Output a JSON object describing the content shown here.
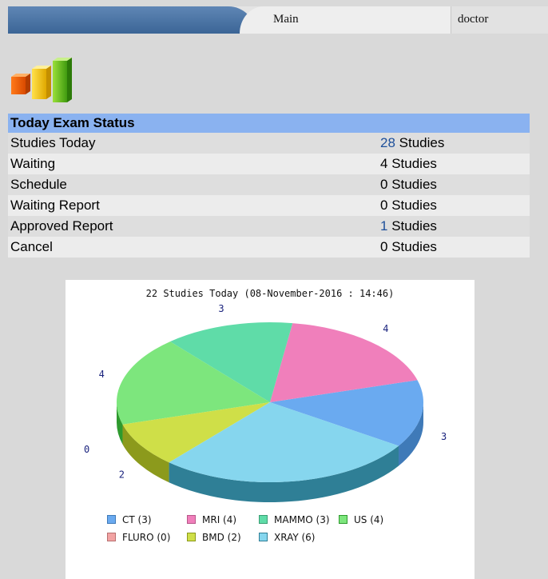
{
  "nav": {
    "tab_main": "Main",
    "tab_user": "doctor"
  },
  "status": {
    "title": "Today Exam Status",
    "rows": [
      {
        "label": "Studies Today",
        "count": "28",
        "unit": " Studies",
        "linked": true
      },
      {
        "label": "Waiting",
        "count": "4",
        "unit": " Studies",
        "linked": false
      },
      {
        "label": "Schedule",
        "count": "0",
        "unit": " Studies",
        "linked": false
      },
      {
        "label": "Waiting Report",
        "count": "0",
        "unit": " Studies",
        "linked": false
      },
      {
        "label": "Approved Report",
        "count": "1",
        "unit": " Studies",
        "linked": true
      },
      {
        "label": "Cancel",
        "count": "0",
        "unit": " Studies",
        "linked": false
      }
    ],
    "header_color": "#8ab2f0",
    "link_color": "#1d4f9a"
  },
  "chart_data": {
    "type": "pie",
    "title": "22 Studies Today (08-November-2016 : 14:46)",
    "slices": [
      {
        "name": "CT",
        "value": 3,
        "color": "#6aaaf0",
        "side": "#3f7ab8"
      },
      {
        "name": "MRI",
        "value": 4,
        "color": "#f07fbb",
        "side": "#b8578a"
      },
      {
        "name": "MAMMO",
        "value": 3,
        "color": "#5fdca8",
        "side": "#3a9e74"
      },
      {
        "name": "US",
        "value": 4,
        "color": "#7de67d",
        "side": "#2e9a2e"
      },
      {
        "name": "FLURO",
        "value": 0,
        "color": "#f2a3a3",
        "side": "#b87070"
      },
      {
        "name": "BMD",
        "value": 2,
        "color": "#cfdf48",
        "side": "#8c9a1c"
      },
      {
        "name": "XRAY",
        "value": 6,
        "color": "#86d6ee",
        "side": "#2f7f96"
      }
    ],
    "legend": [
      "CT (3)",
      "MRI (4)",
      "MAMMO (3)",
      "US (4)",
      "FLURO (0)",
      "BMD (2)",
      "XRAY (6)"
    ],
    "legend_placement": "bottom",
    "label_color": "#1a237e"
  }
}
